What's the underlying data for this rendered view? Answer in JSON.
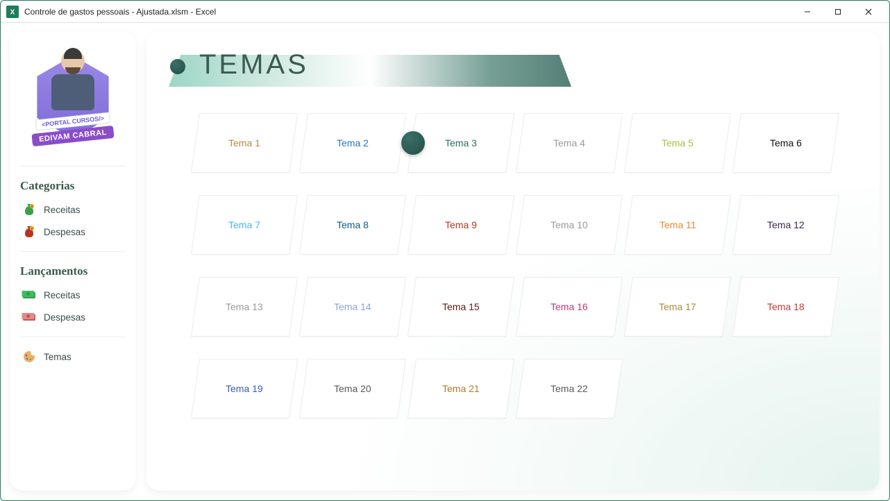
{
  "window": {
    "title": "Controle de gastos pessoais - Ajustada.xlsm - Excel"
  },
  "sidebar": {
    "avatar": {
      "tag1": "<PORTAL CURSOS/>",
      "tag2": "EDIVAM CABRAL"
    },
    "sections": [
      {
        "heading": "Categorias",
        "items": [
          {
            "icon": "money-bag-green-icon",
            "label": "Receitas"
          },
          {
            "icon": "money-bag-red-icon",
            "label": "Despesas"
          }
        ]
      },
      {
        "heading": "Lançamentos",
        "items": [
          {
            "icon": "cash-green-icon",
            "label": "Receitas"
          },
          {
            "icon": "cash-red-icon",
            "label": "Despesas"
          }
        ]
      }
    ],
    "footer": {
      "icon": "palette-icon",
      "label": "Temas"
    }
  },
  "main": {
    "title": "TEMAS",
    "selected": 3,
    "themes": [
      {
        "label": "Tema 1",
        "color": "#b58a46"
      },
      {
        "label": "Tema 2",
        "color": "#2c72c7"
      },
      {
        "label": "Tema 3",
        "color": "#2b6e62"
      },
      {
        "label": "Tema 4",
        "color": "#9a9a9a"
      },
      {
        "label": "Tema 5",
        "color": "#a6c13a"
      },
      {
        "label": "Tema 6",
        "color": "#111111"
      },
      {
        "label": "Tema 7",
        "color": "#49b6e6"
      },
      {
        "label": "Tema 8",
        "color": "#115a86"
      },
      {
        "label": "Tema 9",
        "color": "#b33423"
      },
      {
        "label": "Tema 10",
        "color": "#9a9a9a"
      },
      {
        "label": "Tema 11",
        "color": "#e48b2f"
      },
      {
        "label": "Tema 12",
        "color": "#3a2a4a"
      },
      {
        "label": "Tema 13",
        "color": "#9a9a9a"
      },
      {
        "label": "Tema 14",
        "color": "#8aa4d6"
      },
      {
        "label": "Tema 15",
        "color": "#5a1c12"
      },
      {
        "label": "Tema 16",
        "color": "#c23a7a"
      },
      {
        "label": "Tema 17",
        "color": "#a88a3a"
      },
      {
        "label": "Tema 18",
        "color": "#c23a3a"
      },
      {
        "label": "Tema 19",
        "color": "#3a5ab8"
      },
      {
        "label": "Tema 20",
        "color": "#5a5a5a"
      },
      {
        "label": "Tema 21",
        "color": "#b07a2f"
      },
      {
        "label": "Tema 22",
        "color": "#5a5a5a"
      }
    ]
  }
}
